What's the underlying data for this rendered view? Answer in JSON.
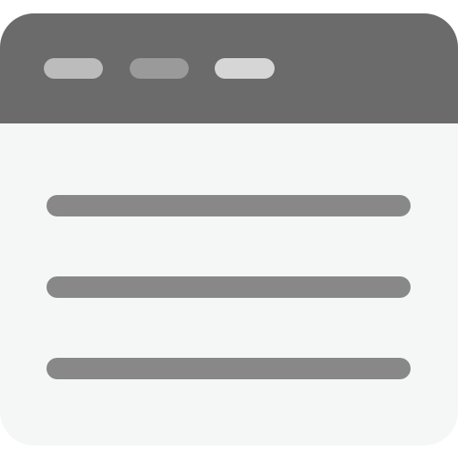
{
  "icon": {
    "name": "browser-window-icon",
    "colors": {
      "titlebar": "#6b6b6b",
      "body": "#f5f6f6",
      "dot_1": "#bcbcbc",
      "dot_2": "#9a9a9a",
      "dot_3": "#d6d6d6",
      "content_line": "#888888"
    },
    "titlebar_dots": [
      {
        "name": "window-dot-1"
      },
      {
        "name": "window-dot-2"
      },
      {
        "name": "window-dot-3"
      }
    ],
    "content_lines": [
      {
        "name": "content-line-1"
      },
      {
        "name": "content-line-2"
      },
      {
        "name": "content-line-3"
      }
    ]
  }
}
